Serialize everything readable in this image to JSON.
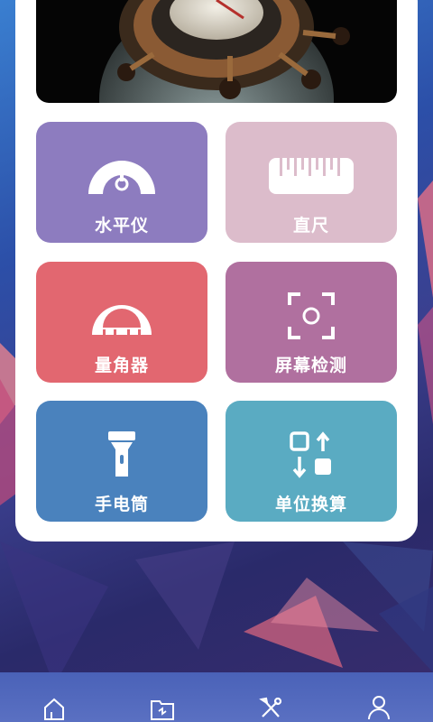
{
  "tools": [
    {
      "label": "水平仪",
      "icon": "level-gauge-icon",
      "color": "#8d7cbf"
    },
    {
      "label": "直尺",
      "icon": "ruler-icon",
      "color": "#dcbccb"
    },
    {
      "label": "量角器",
      "icon": "protractor-icon",
      "color": "#e26770"
    },
    {
      "label": "屏幕检测",
      "icon": "screen-check-icon",
      "color": "#b0709f"
    },
    {
      "label": "手电筒",
      "icon": "flashlight-icon",
      "color": "#4a82bd"
    },
    {
      "label": "单位换算",
      "icon": "unit-convert-icon",
      "color": "#5aabc2"
    }
  ],
  "tabs": [
    {
      "icon": "home-icon"
    },
    {
      "icon": "folder-icon"
    },
    {
      "icon": "tools-icon"
    },
    {
      "icon": "profile-icon"
    }
  ]
}
